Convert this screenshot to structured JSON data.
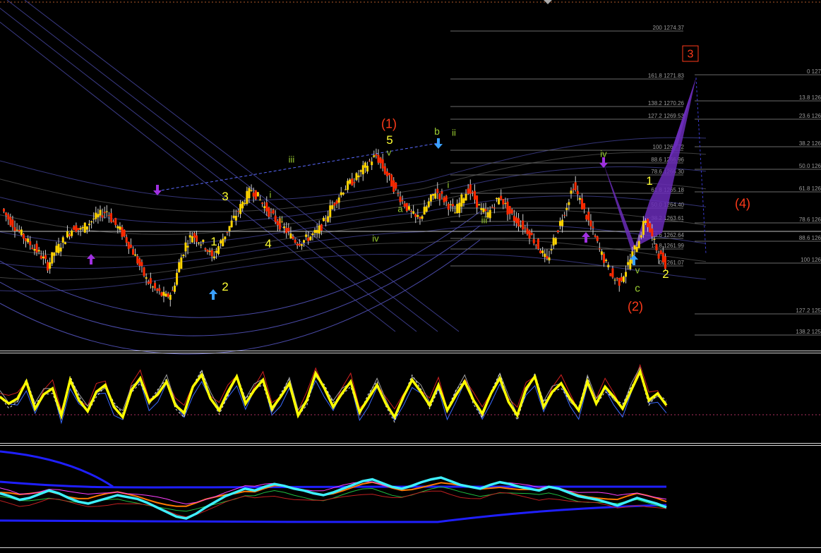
{
  "colors": {
    "background": "#000000",
    "bull_candle": "#ffd400",
    "bear_candle": "#ff2a00",
    "wave_primary": "#ff3a1a",
    "wave_minor": "#ffff33",
    "wave_minute": "#9acd32",
    "fib_text": "#9a9a9a",
    "envelope": "#4a4aa8",
    "pattern_fill": "#6a2cb8",
    "arrow_blue": "#3aa0ff",
    "arrow_purple": "#a030e0",
    "oscillator_main": "#ffff00",
    "rsi_cyan": "#3ef0ff",
    "channel_blue": "#1f1fff"
  },
  "fib_levels_right": [
    {
      "label": "200 1274.37"
    },
    {
      "label": "161.8 1271.83"
    },
    {
      "label": "138.2 1270.26"
    },
    {
      "label": "127.2 1269.53"
    },
    {
      "label": "100 1267.72"
    },
    {
      "label": "88.6 1266.96"
    },
    {
      "label": "78.6 1266.30"
    },
    {
      "label": "61.8 1265.18"
    },
    {
      "label": "50.0 1264.40"
    },
    {
      "label": "38.2 1263.61"
    },
    {
      "label": "23.6 1262.64"
    },
    {
      "label": "13.8 1261.99"
    },
    {
      "label": "0 1261.07"
    }
  ],
  "fib_levels_far_right": [
    {
      "label": "0 127"
    },
    {
      "label": "13.8 126"
    },
    {
      "label": "23.6 126"
    },
    {
      "label": "38.2 126"
    },
    {
      "label": "50.0 126"
    },
    {
      "label": "61.8 126"
    },
    {
      "label": "78.6 126"
    },
    {
      "label": "88.6 126"
    },
    {
      "label": "100 126"
    },
    {
      "label": "127.2 125"
    },
    {
      "label": "138.2 125"
    }
  ],
  "wave_labels": [
    {
      "text": "(1)",
      "cls": "primary"
    },
    {
      "text": "(2)",
      "cls": "primary"
    },
    {
      "text": "3",
      "cls": "primary-boxed"
    },
    {
      "text": "(4)",
      "cls": "primary"
    },
    {
      "text": "1",
      "cls": "minor"
    },
    {
      "text": "2",
      "cls": "minor"
    },
    {
      "text": "3",
      "cls": "minor"
    },
    {
      "text": "4",
      "cls": "minor"
    },
    {
      "text": "5",
      "cls": "minor"
    },
    {
      "text": "1",
      "cls": "minor"
    },
    {
      "text": "2",
      "cls": "minor"
    },
    {
      "text": "i",
      "cls": "minute"
    },
    {
      "text": "ii",
      "cls": "minute"
    },
    {
      "text": "iii",
      "cls": "minute"
    },
    {
      "text": "iv",
      "cls": "minute"
    },
    {
      "text": "v",
      "cls": "minute"
    },
    {
      "text": "a",
      "cls": "minute"
    },
    {
      "text": "b",
      "cls": "minute"
    },
    {
      "text": "i",
      "cls": "minute"
    },
    {
      "text": "ii",
      "cls": "minute"
    },
    {
      "text": "iii",
      "cls": "minute"
    },
    {
      "text": "iv",
      "cls": "minute"
    },
    {
      "text": "v",
      "cls": "minute"
    },
    {
      "text": "c",
      "cls": "minute"
    }
  ],
  "chart_data": [
    {
      "type": "candlestick",
      "pane": "price",
      "title": "",
      "description_series": "price candles with Elliott wave labels and Fibonacci levels",
      "close_path": [
        1265.1,
        1264.6,
        1264.2,
        1263.8,
        1263.4,
        1263.1,
        1262.7,
        1262.2,
        1262.9,
        1263.3,
        1263.8,
        1264.2,
        1264.0,
        1264.3,
        1264.6,
        1264.8,
        1265.0,
        1264.4,
        1264.0,
        1263.5,
        1262.9,
        1262.2,
        1261.5,
        1261.1,
        1260.8,
        1260.6,
        1260.9,
        1262.3,
        1263.3,
        1263.8,
        1263.5,
        1263.2,
        1262.6,
        1263.2,
        1263.8,
        1264.4,
        1265.0,
        1265.6,
        1266.1,
        1265.7,
        1265.2,
        1264.8,
        1264.4,
        1264.1,
        1263.7,
        1263.4,
        1263.5,
        1263.7,
        1263.9,
        1264.4,
        1265.1,
        1265.6,
        1266.1,
        1266.4,
        1266.7,
        1267.1,
        1267.5,
        1267.8,
        1267.2,
        1266.6,
        1266.0,
        1265.5,
        1265.0,
        1264.6,
        1264.8,
        1265.4,
        1266.0,
        1265.7,
        1265.3,
        1264.9,
        1265.6,
        1266.1,
        1265.6,
        1265.0,
        1264.8,
        1265.4,
        1265.7,
        1265.0,
        1264.6,
        1264.3,
        1264.0,
        1263.5,
        1263.0,
        1262.4,
        1263.5,
        1264.4,
        1265.3,
        1266.3,
        1265.5,
        1264.7,
        1263.9,
        1263.0,
        1262.3,
        1261.6,
        1261.4,
        1262.0,
        1262.8,
        1263.6,
        1264.6,
        1263.6,
        1262.8,
        1262.3
      ],
      "ylim": [
        1258.0,
        1275.5
      ],
      "fib_retracement_values": [
        1274.37,
        1271.83,
        1270.26,
        1269.53,
        1267.72,
        1266.96,
        1266.3,
        1265.18,
        1264.4,
        1263.61,
        1262.64,
        1261.99,
        1261.07
      ]
    },
    {
      "type": "line",
      "pane": "oscillator",
      "ylim": [
        0,
        100
      ],
      "series": [
        {
          "values": [
            52,
            44,
            50,
            70,
            38,
            55,
            62,
            30,
            72,
            48,
            35,
            58,
            66,
            40,
            28,
            60,
            74,
            46,
            55,
            70,
            42,
            33,
            64,
            78,
            50,
            36,
            58,
            76,
            44,
            60,
            72,
            38,
            52,
            68,
            30,
            48,
            80,
            62,
            40,
            56,
            70,
            34,
            50,
            66,
            44,
            28,
            52,
            72,
            58,
            42,
            66,
            36,
            54,
            70,
            48,
            32,
            56,
            74,
            46,
            30,
            62,
            76,
            40,
            58,
            68,
            50,
            36,
            70,
            44,
            64,
            52,
            38,
            60,
            82,
            48,
            56,
            42
          ]
        }
      ]
    },
    {
      "type": "line",
      "pane": "rsi",
      "ylim": [
        0,
        100
      ],
      "series": [
        {
          "values": [
            55,
            52,
            48,
            50,
            54,
            58,
            55,
            50,
            46,
            44,
            47,
            50,
            53,
            51,
            49,
            45,
            40,
            35,
            30,
            28,
            33,
            40,
            46,
            52,
            56,
            60,
            58,
            62,
            65,
            63,
            60,
            58,
            55,
            53,
            56,
            60,
            64,
            68,
            70,
            66,
            62,
            60,
            63,
            67,
            70,
            72,
            68,
            64,
            62,
            60,
            64,
            67,
            65,
            62,
            60,
            58,
            62,
            60,
            56,
            52,
            50,
            48,
            45,
            42,
            46,
            50,
            47,
            44,
            40
          ]
        }
      ]
    }
  ]
}
